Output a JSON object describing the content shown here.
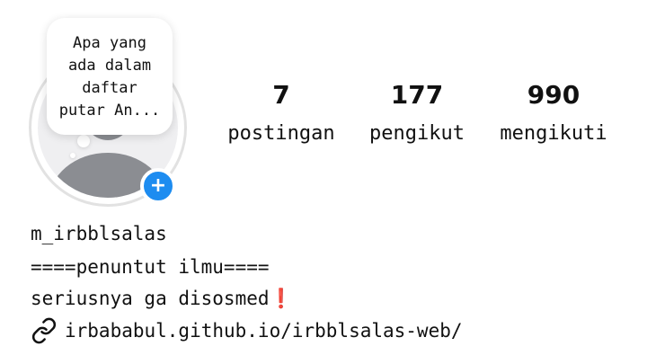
{
  "profile": {
    "note_text": "Apa yang ada dalam daftar putar An...",
    "add_icon": "+",
    "stats": [
      {
        "value": "7",
        "label": "postingan"
      },
      {
        "value": "177",
        "label": "pengikut"
      },
      {
        "value": "990",
        "label": "mengikuti"
      }
    ],
    "username": "m_irbblsalas",
    "bio_line1": "====penuntut ilmu====",
    "bio_line2": "seriusnya ga disosmed",
    "bio_line2_emoji": "❗",
    "link": "irbababul.github.io/irbblsalas-web/",
    "link_icon": "link-icon"
  },
  "colors": {
    "badge_blue": "#1d8cf0",
    "avatar_gray": "#8b8d92",
    "exclaim_red": "#e0303a"
  }
}
